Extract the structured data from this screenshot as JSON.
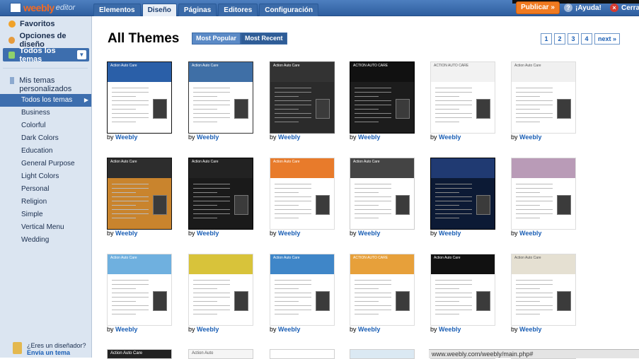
{
  "app": {
    "logo": "weebly",
    "logo_suffix": "editor"
  },
  "tabs": [
    {
      "label": "Elementos",
      "active": false
    },
    {
      "label": "Diseño",
      "active": true
    },
    {
      "label": "Páginas",
      "active": false
    },
    {
      "label": "Editores",
      "active": false
    },
    {
      "label": "Configuración",
      "active": false
    }
  ],
  "topbar": {
    "publish": "Publicar »",
    "help": "¡Ayuda!",
    "close": "Cerrar"
  },
  "sidebar": {
    "favorites": "Favoritos",
    "design_options": "Opciones de diseño",
    "all_themes": "Todos los temas",
    "my_themes": "Mis temas personalizados",
    "categories": [
      "Todos los temas",
      "Business",
      "Colorful",
      "Dark Colors",
      "Education",
      "General Purpose",
      "Light Colors",
      "Personal",
      "Religion",
      "Simple",
      "Vertical Menu",
      "Wedding"
    ],
    "selected_category": "Todos los temas",
    "designer_question": "¿Eres un diseñador?",
    "designer_link": "Envía un tema"
  },
  "main": {
    "heading": "All Themes",
    "sort": [
      {
        "label": "Most Popular",
        "active": false
      },
      {
        "label": "Most Recent",
        "active": true
      }
    ],
    "pages": [
      "1",
      "2",
      "3",
      "4",
      "next »"
    ],
    "by_prefix": "by",
    "author": "Weebly",
    "themes": [
      {
        "title": "Action Auto Care",
        "hdr": "#2a5fa8",
        "bg": "#ffffff",
        "frame": "#111111"
      },
      {
        "title": "Action Auto Care",
        "hdr": "#3f6fa6",
        "bg": "#ffffff",
        "frame": "#333333"
      },
      {
        "title": "Action Auto Care",
        "hdr": "#333333",
        "bg": "#2b2b2b",
        "frame": "#555555"
      },
      {
        "title": "ACTION AUTO CARE",
        "hdr": "#111111",
        "bg": "#1c1c1c",
        "frame": "#000000"
      },
      {
        "title": "ACTION AUTO CARE",
        "hdr": "#f2f2f2",
        "bg": "#ffffff",
        "frame": "#dddddd"
      },
      {
        "title": "Action Auto Care",
        "hdr": "#f0f0f0",
        "bg": "#ffffff",
        "frame": "#dddddd"
      },
      {
        "title": "Action Auto Care",
        "hdr": "#2d2d2d",
        "bg": "#c9842d",
        "frame": "#111111"
      },
      {
        "title": "Action Auto Care",
        "hdr": "#222222",
        "bg": "#1a1a1a",
        "frame": "#000000"
      },
      {
        "title": "Action Auto Care",
        "hdr": "#e87b2b",
        "bg": "#ffffff",
        "frame": "#dddddd"
      },
      {
        "title": "Action Auto Care",
        "hdr": "#444444",
        "bg": "#ffffff",
        "frame": "#cccccc"
      },
      {
        "title": "",
        "hdr": "#203a72",
        "bg": "#0c1a35",
        "frame": "#000000"
      },
      {
        "title": "",
        "hdr": "#b99bb7",
        "bg": "#ffffff",
        "frame": "#dddddd"
      },
      {
        "title": "Action Auto Care",
        "hdr": "#6fb0df",
        "bg": "#ffffff",
        "frame": "#dddddd"
      },
      {
        "title": "",
        "hdr": "#d8c33a",
        "bg": "#ffffff",
        "frame": "#dddddd"
      },
      {
        "title": "Action Auto Care",
        "hdr": "#3f86c8",
        "bg": "#ffffff",
        "frame": "#dddddd"
      },
      {
        "title": "ACTION AUTO CARE",
        "hdr": "#e7a03a",
        "bg": "#ffffff",
        "frame": "#dddddd"
      },
      {
        "title": "Action Auto Care",
        "hdr": "#111111",
        "bg": "#ffffff",
        "frame": "#dddddd"
      },
      {
        "title": "Action Auto Care",
        "hdr": "#e5e0d2",
        "bg": "#ffffff",
        "frame": "#dddddd"
      }
    ],
    "partial_row": [
      "Action Auto Care",
      "Action Auto",
      "",
      "",
      "",
      ""
    ]
  },
  "status_url": "www.weebly.com/weebly/main.php#"
}
